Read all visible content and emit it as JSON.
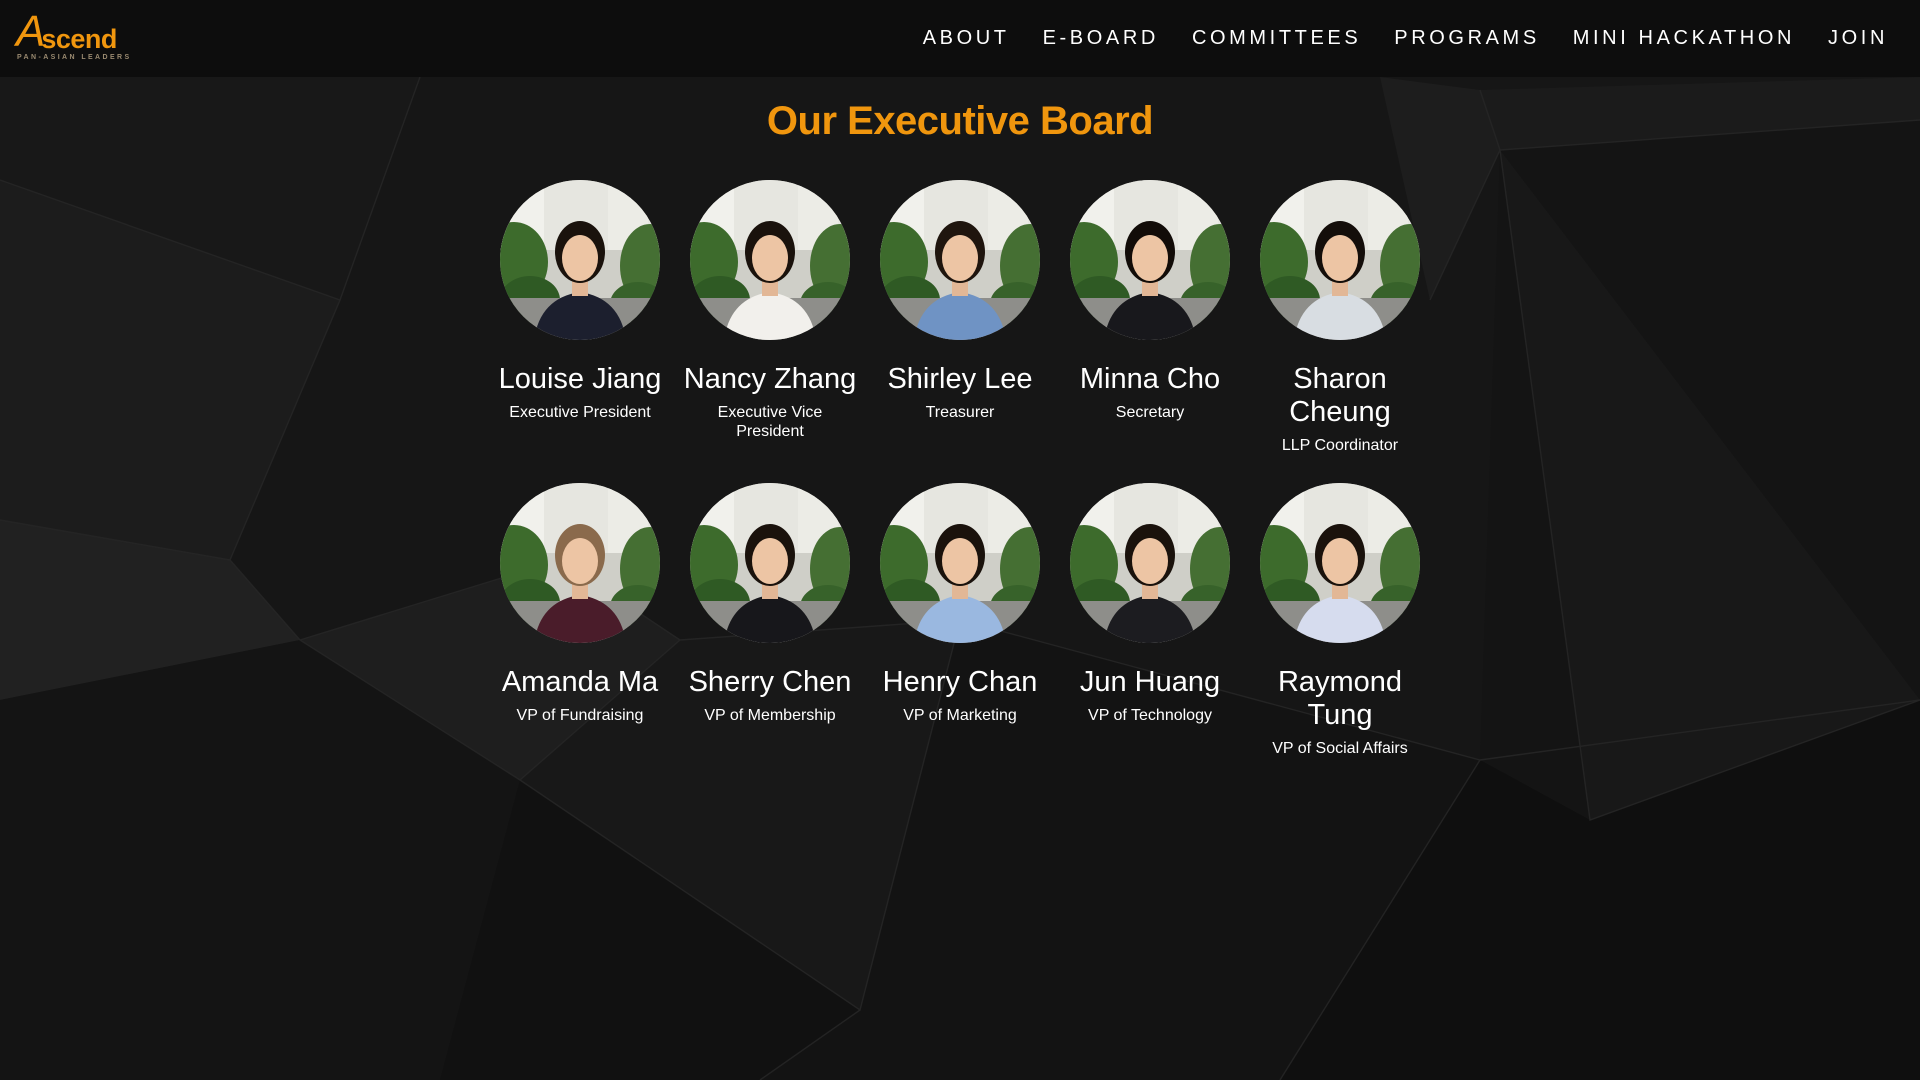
{
  "nav": {
    "logo_text": "Ascend",
    "logo_tagline": "PAN-ASIAN LEADERS",
    "links": [
      "ABOUT",
      "E-BOARD",
      "COMMITTEES",
      "PROGRAMS",
      "MINI HACKATHON",
      "JOIN"
    ]
  },
  "board": {
    "title": "Our Executive Board",
    "members": [
      {
        "name": "Louise Jiang",
        "role": "Executive President",
        "top": "#1c1f2e",
        "hair": "#1a120c"
      },
      {
        "name": "Nancy Zhang",
        "role": "Executive Vice President",
        "top": "#f2f0ec",
        "hair": "#1a120c"
      },
      {
        "name": "Shirley Lee",
        "role": "Treasurer",
        "top": "#6f93c4",
        "hair": "#1f150e"
      },
      {
        "name": "Minna Cho",
        "role": "Secretary",
        "top": "#18181c",
        "hair": "#120c08"
      },
      {
        "name": "Sharon Cheung",
        "role": "LLP Coordinator",
        "top": "#d8dde2",
        "hair": "#140e0a"
      },
      {
        "name": "Amanda Ma",
        "role": "VP of Fundraising",
        "top": "#4a1c2a",
        "hair": "#8a6a4c"
      },
      {
        "name": "Sherry Chen",
        "role": "VP of Membership",
        "top": "#17171b",
        "hair": "#1a120c"
      },
      {
        "name": "Henry Chan",
        "role": "VP of Marketing",
        "top": "#9ab8e0",
        "hair": "#1a120c"
      },
      {
        "name": "Jun Huang",
        "role": "VP of Technology",
        "top": "#1c1c20",
        "hair": "#1a120c"
      },
      {
        "name": "Raymond Tung",
        "role": "VP of Social Affairs",
        "top": "#d6dcee",
        "hair": "#1a120c"
      }
    ]
  },
  "colors": {
    "accent": "#f0960e",
    "background": "#151515",
    "navbar": "#0d0d0d",
    "text": "#ffffff"
  }
}
